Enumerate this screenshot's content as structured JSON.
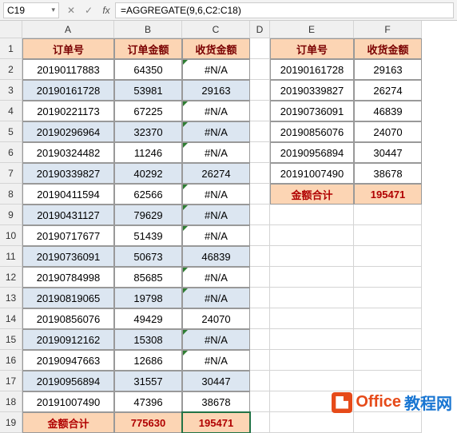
{
  "namebox": "C19",
  "formula": "=AGGREGATE(9,6,C2:C18)",
  "cols": [
    "",
    "A",
    "B",
    "C",
    "D",
    "E",
    "F"
  ],
  "rows": [
    "1",
    "2",
    "3",
    "4",
    "5",
    "6",
    "7",
    "8",
    "9",
    "10",
    "11",
    "12",
    "13",
    "14",
    "15",
    "16",
    "17",
    "18",
    "19"
  ],
  "head1": {
    "A": "订单号",
    "B": "订单金额",
    "C": "收货金额"
  },
  "data1": [
    {
      "A": "20190117883",
      "B": "64350",
      "C": "#N/A",
      "alt": false,
      "triC": true
    },
    {
      "A": "20190161728",
      "B": "53981",
      "C": "29163",
      "alt": true,
      "triC": false
    },
    {
      "A": "20190221173",
      "B": "67225",
      "C": "#N/A",
      "alt": false,
      "triC": true
    },
    {
      "A": "20190296964",
      "B": "32370",
      "C": "#N/A",
      "alt": true,
      "triC": true
    },
    {
      "A": "20190324482",
      "B": "11246",
      "C": "#N/A",
      "alt": false,
      "triC": true
    },
    {
      "A": "20190339827",
      "B": "40292",
      "C": "26274",
      "alt": true,
      "triC": false
    },
    {
      "A": "20190411594",
      "B": "62566",
      "C": "#N/A",
      "alt": false,
      "triC": true
    },
    {
      "A": "20190431127",
      "B": "79629",
      "C": "#N/A",
      "alt": true,
      "triC": true
    },
    {
      "A": "20190717677",
      "B": "51439",
      "C": "#N/A",
      "alt": false,
      "triC": true
    },
    {
      "A": "20190736091",
      "B": "50673",
      "C": "46839",
      "alt": true,
      "triC": false
    },
    {
      "A": "20190784998",
      "B": "85685",
      "C": "#N/A",
      "alt": false,
      "triC": true
    },
    {
      "A": "20190819065",
      "B": "19798",
      "C": "#N/A",
      "alt": true,
      "triC": true
    },
    {
      "A": "20190856076",
      "B": "49429",
      "C": "24070",
      "alt": false,
      "triC": false
    },
    {
      "A": "20190912162",
      "B": "15308",
      "C": "#N/A",
      "alt": true,
      "triC": true
    },
    {
      "A": "20190947663",
      "B": "12686",
      "C": "#N/A",
      "alt": false,
      "triC": true
    },
    {
      "A": "20190956894",
      "B": "31557",
      "C": "30447",
      "alt": true,
      "triC": false
    },
    {
      "A": "20191007490",
      "B": "47396",
      "C": "38678",
      "alt": false,
      "triC": false
    }
  ],
  "sum1": {
    "A": "金额合计",
    "B": "775630",
    "C": "195471"
  },
  "head2": {
    "E": "订单号",
    "F": "收货金额"
  },
  "data2": [
    {
      "E": "20190161728",
      "F": "29163"
    },
    {
      "E": "20190339827",
      "F": "26274"
    },
    {
      "E": "20190736091",
      "F": "46839"
    },
    {
      "E": "20190856076",
      "F": "24070"
    },
    {
      "E": "20190956894",
      "F": "30447"
    },
    {
      "E": "20191007490",
      "F": "38678"
    }
  ],
  "sum2": {
    "E": "金额合计",
    "F": "195471"
  },
  "watermark": {
    "t1": "Office",
    "t2": "教程网"
  }
}
